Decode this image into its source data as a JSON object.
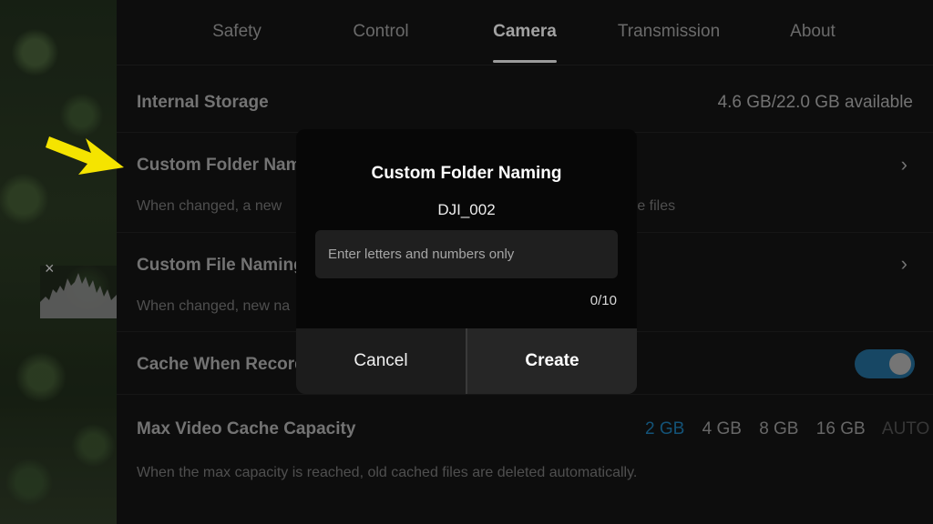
{
  "tabs": [
    {
      "label": "Safety"
    },
    {
      "label": "Control"
    },
    {
      "label": "Camera"
    },
    {
      "label": "Transmission"
    },
    {
      "label": "About"
    }
  ],
  "active_tab": "Camera",
  "settings": {
    "internal_storage": {
      "label": "Internal Storage",
      "value": "4.6 GB/22.0 GB available"
    },
    "custom_folder": {
      "label": "Custom Folder Naming",
      "desc_visible_start": "When changed, a new",
      "desc_visible_end": "re files"
    },
    "custom_file": {
      "label": "Custom File Naming",
      "desc_visible_start": "When changed, new na"
    },
    "cache_when_recording": {
      "label": "Cache When Recording",
      "enabled": true
    },
    "max_video_cache": {
      "label": "Max Video Cache Capacity",
      "options": [
        "2 GB",
        "4 GB",
        "8 GB",
        "16 GB",
        "AUTO"
      ],
      "selected": "2 GB",
      "desc": "When the max capacity is reached, old cached files are deleted automatically."
    }
  },
  "modal": {
    "title": "Custom Folder Naming",
    "current_name": "DJI_002",
    "input_placeholder": "Enter letters and numbers only",
    "input_value": "",
    "char_count": "0/10",
    "cancel_label": "Cancel",
    "create_label": "Create"
  },
  "colors": {
    "accent": "#1a6fa0",
    "toggle_on": "#1f5f86",
    "annotation_arrow": "#f5e400"
  },
  "icons": {
    "row_chevron": "chevron-right-icon",
    "histogram_close": "close-icon"
  }
}
